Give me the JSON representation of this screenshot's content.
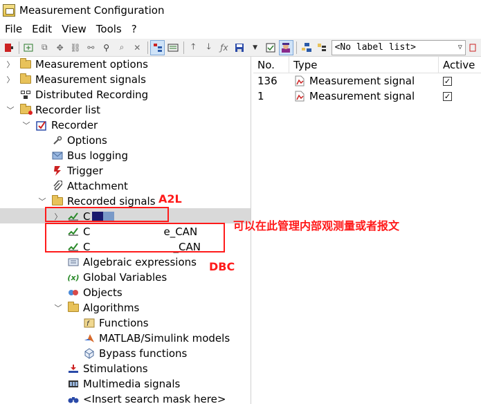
{
  "window": {
    "title": "Measurement Configuration"
  },
  "menu": [
    "File",
    "Edit",
    "View",
    "Tools",
    "?"
  ],
  "toolbar": {
    "label_list": "<No label list>"
  },
  "tree": {
    "measurement_options": "Measurement options",
    "measurement_signals": "Measurement signals",
    "distributed_recording": "Distributed Recording",
    "recorder_list": "Recorder list",
    "recorder": "Recorder",
    "options": "Options",
    "bus_logging": "Bus logging",
    "trigger": "Trigger",
    "attachment": "Attachment",
    "recorded_signals": "Recorded signals",
    "signal_a2l": "C",
    "signal_dbc1_prefix": "C",
    "signal_dbc1_suffix": "e_CAN",
    "signal_dbc2_prefix": "C",
    "signal_dbc2_suffix": "_CAN",
    "algebraic_expressions": "Algebraic expressions",
    "global_variables": "Global Variables",
    "objects": "Objects",
    "algorithms": "Algorithms",
    "functions": "Functions",
    "matlab_simulink": "MATLAB/Simulink models",
    "bypass_functions": "Bypass functions",
    "stimulations": "Stimulations",
    "multimedia_signals": "Multimedia signals",
    "insert_search_mask": "<Insert search mask here>"
  },
  "table": {
    "headers": {
      "no": "No.",
      "type": "Type",
      "active": "Active"
    },
    "rows": [
      {
        "no": "136",
        "type": "Measurement signal",
        "active": "✓"
      },
      {
        "no": "1",
        "type": "Measurement signal",
        "active": "✓"
      }
    ]
  },
  "annotations": {
    "a2l": "A2L",
    "dbc": "DBC",
    "note": "可以在此管理内部观测量或者报文"
  },
  "colors": {
    "annotation": "#ff1a1a",
    "selection": "#d9d9d9",
    "redaction": "#1a1a6e"
  }
}
